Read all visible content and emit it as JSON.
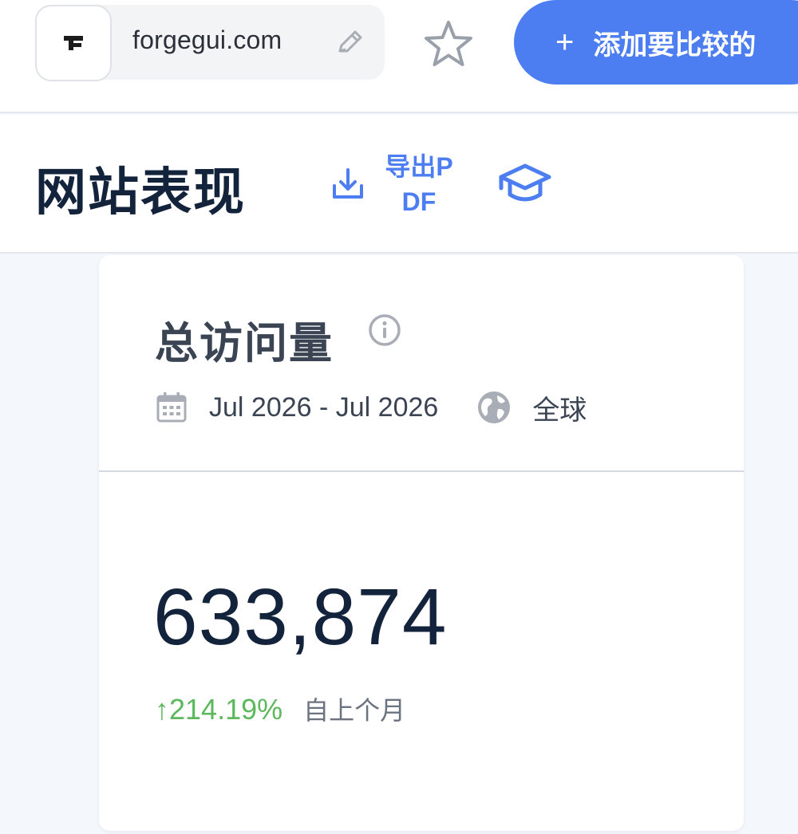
{
  "topbar": {
    "site_domain": "forgegui.com",
    "compare_button_label": "添加要比较的",
    "icons": {
      "favicon": "forge-logo-icon",
      "edit": "pencil-icon",
      "favorite": "star-outline-icon",
      "add": "plus-icon"
    }
  },
  "header": {
    "title": "网站表现",
    "export_label": "导出PDF",
    "icons": {
      "export": "download-icon",
      "academy": "graduation-cap-icon"
    }
  },
  "card": {
    "title": "总访问量",
    "date_range": "Jul 2026 - Jul 2026",
    "region": "全球",
    "visits": "633,874",
    "change": "↑214.19%",
    "change_caption": "自上个月",
    "icons": {
      "info": "info-icon",
      "calendar": "calendar-icon",
      "region": "globe-icon"
    }
  },
  "colors": {
    "accent": "#4c7ef2",
    "title_text": "#14233c",
    "positive": "#5cb85c",
    "muted_text": "#6c7380",
    "page_background": "#f4f7fc"
  }
}
